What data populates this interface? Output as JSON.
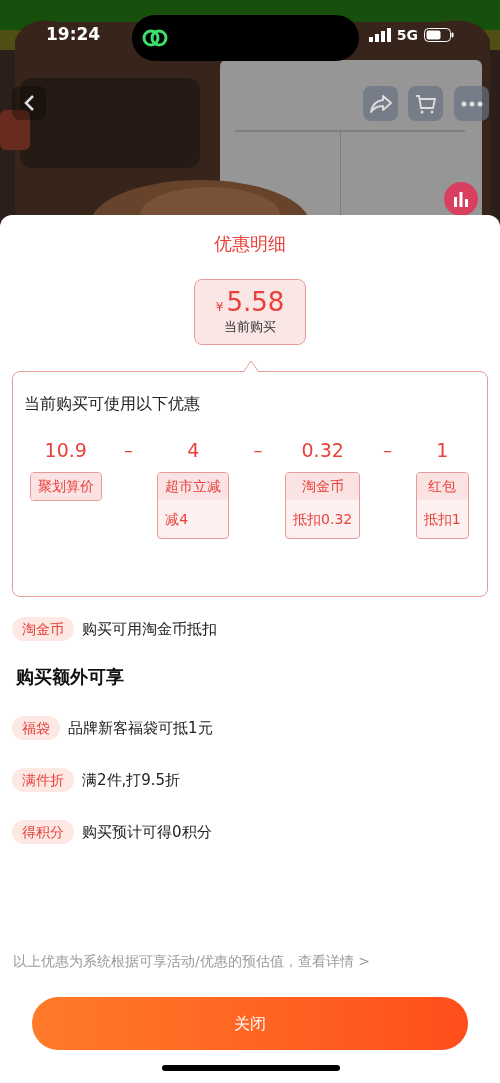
{
  "status_bar": {
    "time": "19:24",
    "network": "5G"
  },
  "title": "优惠明细",
  "price": {
    "currency": "¥",
    "amount": "5.58",
    "label": "当前购买"
  },
  "breakdown": {
    "heading": "当前购买可使用以下优惠",
    "items": [
      {
        "amount": "10.9",
        "tag": "聚划算价"
      },
      {
        "operator": "–",
        "amount": "4",
        "tag": "超市立减",
        "detail": "减4"
      },
      {
        "operator": "–",
        "amount": "0.32",
        "tag": "淘金币",
        "detail": "抵扣0.32"
      },
      {
        "operator": "–",
        "amount": "1",
        "tag": "红包",
        "detail": "抵扣1"
      }
    ]
  },
  "coin_row": {
    "tag": "淘金币",
    "text": "购买可用淘金币抵扣"
  },
  "extras": {
    "heading": "购买额外可享",
    "items": [
      {
        "tag": "福袋",
        "text": "品牌新客福袋可抵1元"
      },
      {
        "tag": "满件折",
        "text": "满2件,打9.5折"
      },
      {
        "tag": "得积分",
        "text": "购买预计可得0积分"
      }
    ]
  },
  "footnote": {
    "text": "以上优惠为系统根据可享活动/优惠的预估值，",
    "link": "查看详情 >"
  },
  "close_button": "关闭"
}
